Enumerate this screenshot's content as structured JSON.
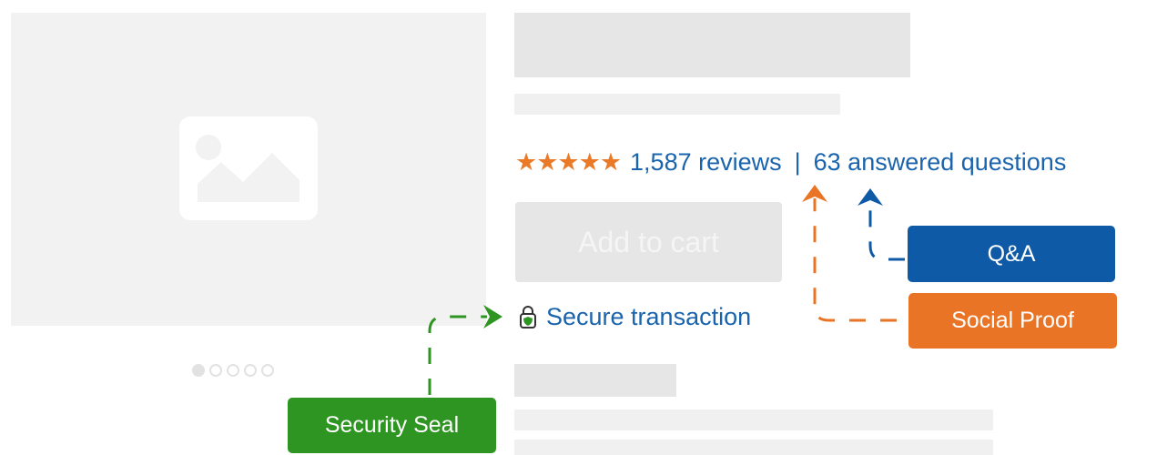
{
  "rating": {
    "stars": "★★★★★",
    "reviews_label": "1,587 reviews",
    "separator": "|",
    "questions_label": "63 answered questions"
  },
  "cart": {
    "button_label": "Add to cart"
  },
  "secure": {
    "label": "Secure transaction"
  },
  "callouts": {
    "qa_label": "Q&A",
    "social_label": "Social Proof",
    "seal_label": "Security Seal"
  },
  "colors": {
    "blue": "#1a64ad",
    "orange": "#ea7425",
    "green": "#2e9422",
    "skeleton": "#e6e6e6"
  },
  "image_gallery": {
    "dot_count": 5,
    "active_dot": 1
  }
}
